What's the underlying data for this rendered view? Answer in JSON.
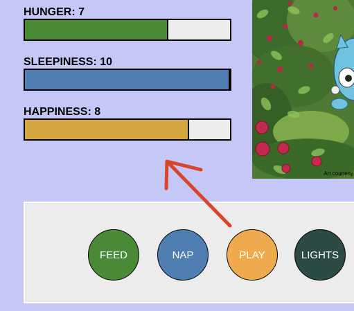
{
  "stats": [
    {
      "key": "hunger",
      "label": "HUNGER: 7",
      "value": 7,
      "max": 10,
      "color": "#4a8a36"
    },
    {
      "key": "sleepiness",
      "label": "SLEEPINESS: 10",
      "value": 10,
      "max": 10,
      "color": "#4f7fb2"
    },
    {
      "key": "happiness",
      "label": "HAPPINESS: 8",
      "value": 8,
      "max": 10,
      "color": "#d6a640"
    }
  ],
  "scene": {
    "credit": "Art courtesy"
  },
  "actions": [
    {
      "key": "feed",
      "label": "FEED",
      "color": "#4a8a36"
    },
    {
      "key": "nap",
      "label": "NAP",
      "color": "#4f7fb2"
    },
    {
      "key": "play",
      "label": "PLAY",
      "color": "#efaa4e"
    },
    {
      "key": "lights",
      "label": "LIGHTS",
      "color": "#2d4b45"
    }
  ],
  "colors": {
    "background": "#c5c8f7",
    "panel": "#ececec",
    "annotation_arrow": "#d9452b"
  }
}
